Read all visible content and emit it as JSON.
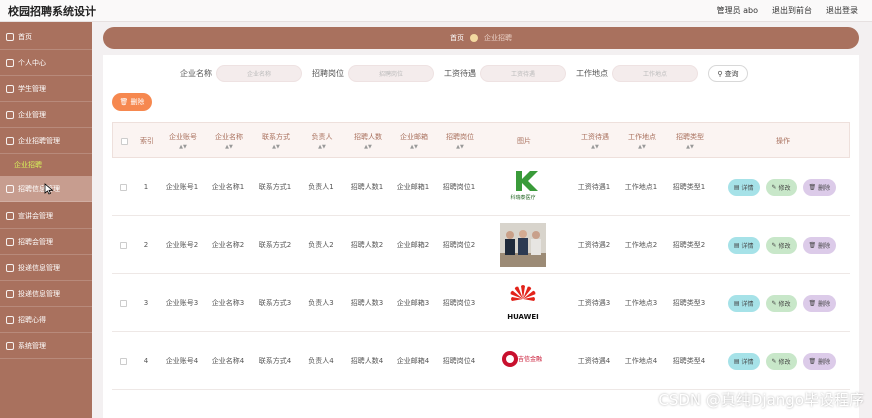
{
  "app": {
    "title": "校园招聘系统设计"
  },
  "topbar": {
    "user": "管理员 abo",
    "back_to_front": "退出到前台",
    "logout": "退出登录"
  },
  "sidebar": {
    "items": [
      {
        "label": "首页"
      },
      {
        "label": "个人中心"
      },
      {
        "label": "学生管理"
      },
      {
        "label": "企业管理"
      },
      {
        "label": "企业招聘管理"
      },
      {
        "label": "招聘信息管理"
      },
      {
        "label": "宣讲会管理"
      },
      {
        "label": "招聘会管理"
      },
      {
        "label": "投递信息管理"
      },
      {
        "label": "投递信息管理"
      },
      {
        "label": "招聘心得"
      },
      {
        "label": "系统管理"
      }
    ],
    "sub_item": "企业招聘"
  },
  "breadcrumb": {
    "home": "首页",
    "current": "企业招聘"
  },
  "search": {
    "fields": [
      {
        "label": "企业名称",
        "placeholder": "企业名称"
      },
      {
        "label": "招聘岗位",
        "placeholder": "招聘岗位"
      },
      {
        "label": "工资待遇",
        "placeholder": "工资待遇"
      },
      {
        "label": "工作地点",
        "placeholder": "工作地点"
      }
    ],
    "query_label": "查询"
  },
  "toolbar": {
    "delete_label": "删除"
  },
  "table": {
    "headers": [
      "索引",
      "企业账号",
      "企业名称",
      "联系方式",
      "负责人",
      "招聘人数",
      "企业邮箱",
      "招聘岗位",
      "图片",
      "工资待遇",
      "工作地点",
      "招聘类型",
      "操作"
    ],
    "rows": [
      {
        "index": "1",
        "account": "企业账号1",
        "name": "企业名称1",
        "contact": "联系方式1",
        "person": "负责人1",
        "count": "招聘人数1",
        "email": "企业邮箱1",
        "position": "招聘岗位1",
        "image": "logo-image",
        "salary": "工资待遇1",
        "location": "工作地点1",
        "type": "招聘类型1"
      },
      {
        "index": "2",
        "account": "企业账号2",
        "name": "企业名称2",
        "contact": "联系方式2",
        "person": "负责人2",
        "count": "招聘人数2",
        "email": "企业邮箱2",
        "position": "招聘岗位2",
        "image": "photo-image",
        "salary": "工资待遇2",
        "location": "工作地点2",
        "type": "招聘类型2"
      },
      {
        "index": "3",
        "account": "企业账号3",
        "name": "企业名称3",
        "contact": "联系方式3",
        "person": "负责人3",
        "count": "招聘人数3",
        "email": "企业邮箱3",
        "position": "招聘岗位3",
        "image": "logo-image",
        "salary": "工资待遇3",
        "location": "工作地点3",
        "type": "招聘类型3"
      },
      {
        "index": "4",
        "account": "企业账号4",
        "name": "企业名称4",
        "contact": "联系方式4",
        "person": "负责人4",
        "count": "招聘人数4",
        "email": "企业邮箱4",
        "position": "招聘岗位4",
        "image": "logo-image",
        "salary": "工资待遇4",
        "location": "工作地点4",
        "type": "招聘类型4"
      }
    ],
    "logo_texts": [
      "科瑞泰医疗",
      "HUAWEI",
      "吉信金融"
    ],
    "op_labels": {
      "detail": "详情",
      "edit": "修改",
      "delete": "删除"
    }
  },
  "watermark": "CSDN @真纯Django毕设程序",
  "colors": {
    "sidebar": "#a9715e",
    "accent_orange": "#f6884f",
    "detail_btn": "#a6e2e8",
    "edit_btn": "#c8e7c9",
    "delete_btn": "#dccbe9"
  }
}
